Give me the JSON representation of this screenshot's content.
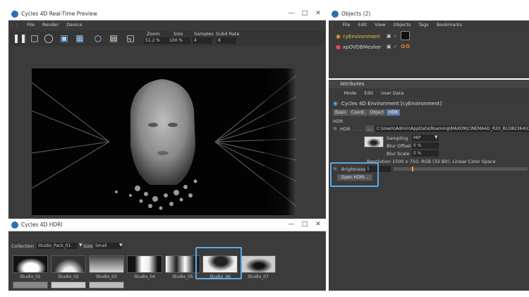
{
  "preview": {
    "title": "Cycles 4D Real-Time Preview",
    "menu": [
      "File",
      "Render",
      "Device"
    ],
    "labels": {
      "zoom": "Zoom",
      "size": "Size",
      "samples": "Samples",
      "subd": "Subd Rate"
    },
    "values": {
      "zoom": "51.2 %",
      "size": "100 %",
      "samples": "4",
      "subd": "8"
    }
  },
  "hdri": {
    "title": "Cycles 4D HDRI",
    "collection_label": "Collection",
    "collection_value": "Studio_Pack_01",
    "size_label": "Size",
    "size_value": "Small",
    "items": [
      "Studio_01",
      "Studio_02",
      "Studio_03",
      "Studio_04",
      "Studio_05",
      "Studio_06",
      "Studio_07"
    ]
  },
  "objects": {
    "title": "Objects (2)",
    "menu": [
      "File",
      "Edit",
      "View",
      "Objects",
      "Tags",
      "Bookmarks"
    ],
    "rows": [
      "cyEnvironment",
      "xpOVDBMesher"
    ]
  },
  "attributes": {
    "title": "Attributes",
    "menu": [
      "Mode",
      "Edit",
      "User Data"
    ],
    "object_name": "Cycles 4D Environment [cyEnvironment]",
    "tabs": [
      "Basic",
      "Coord.",
      "Object",
      "HDR"
    ],
    "section": "HDR",
    "hdr_label": "HDR . . . .",
    "hdr_path": "C:\\Users\\Admin\\AppData\\Roaming\\MAXON\\CINEMA4D_R20_B1D82364\\Cyc",
    "sampling_label": "Sampling",
    "sampling_value": "MIP",
    "blur_offset_label": "Blur Offset",
    "blur_offset_value": "0 %",
    "blur_scale_label": "Blur Scale",
    "blur_scale_value": "0 %",
    "resolution": "Resolution 1500 x 750, RGB (32 Bit), Linear Color Space",
    "brightness_label": "Brightness",
    "brightness_value": "1",
    "open_button": "Open HDRI..."
  },
  "colors": {
    "accent": "#5aa9e6",
    "panel": "#3b3b3b",
    "highlight_text": "#f0c040"
  }
}
